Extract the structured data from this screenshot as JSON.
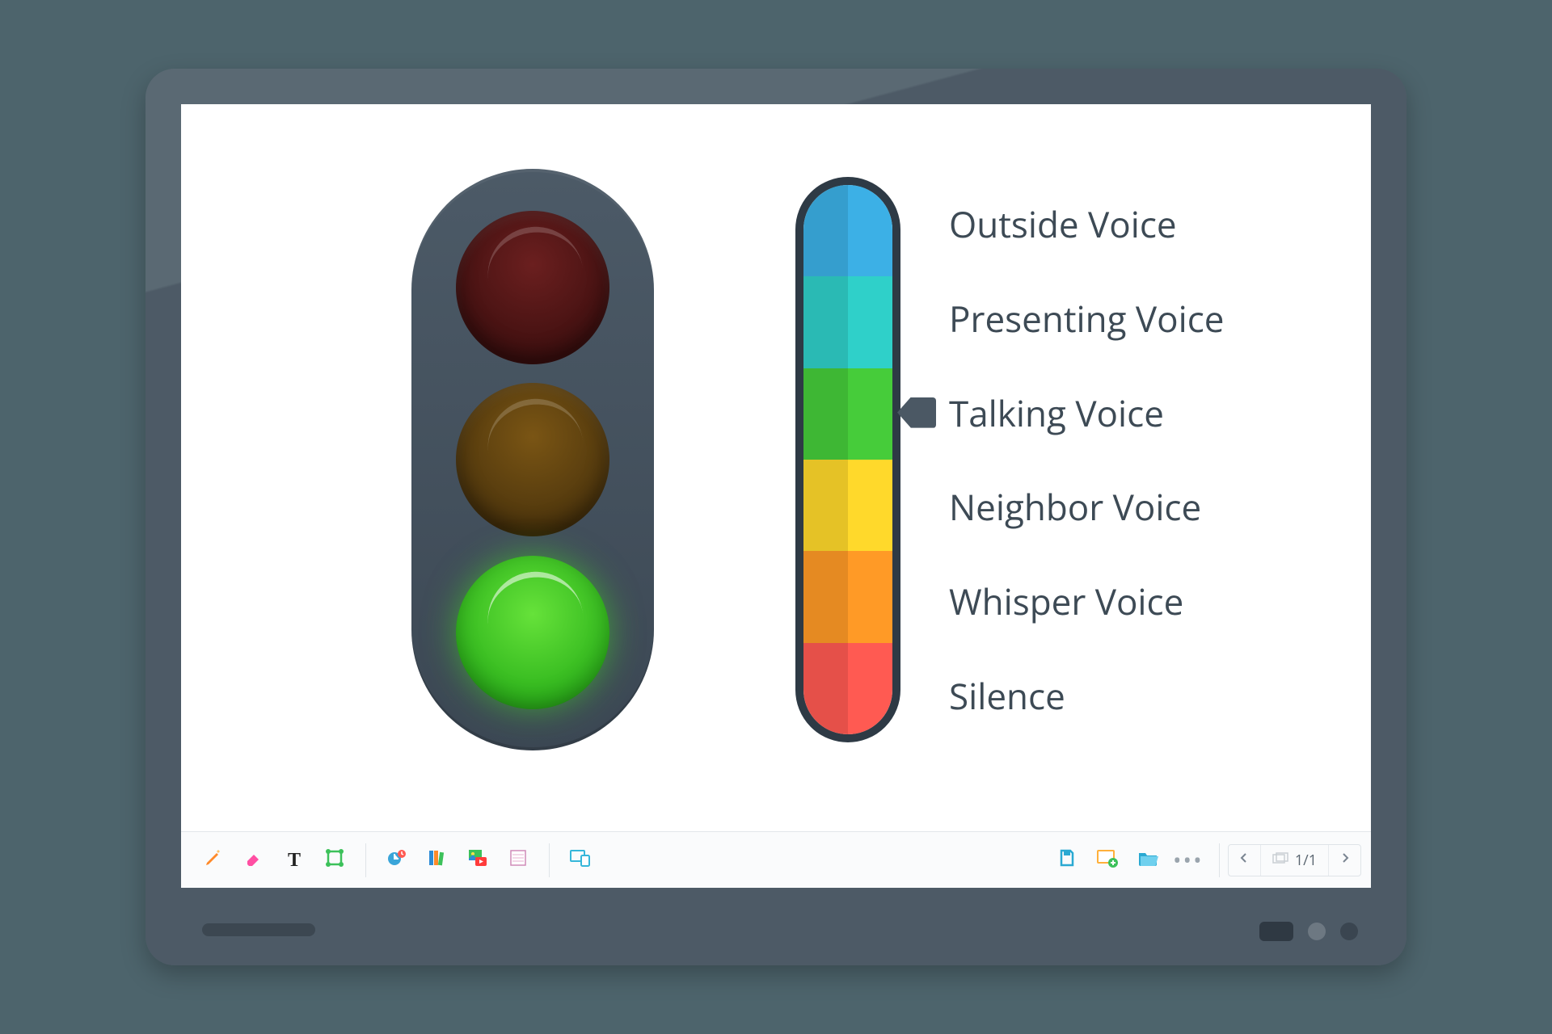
{
  "voice_levels": [
    {
      "label": "Outside Voice",
      "color": "#3cb0e6"
    },
    {
      "label": "Presenting Voice",
      "color": "#2fd0c9"
    },
    {
      "label": "Talking Voice",
      "color": "#46cc3a"
    },
    {
      "label": "Neighbor Voice",
      "color": "#ffd92b"
    },
    {
      "label": "Whisper Voice",
      "color": "#ff9a26"
    },
    {
      "label": "Silence",
      "color": "#ff5a52"
    }
  ],
  "selected_voice_index": 2,
  "traffic_light_state": "green",
  "toolbar": {
    "text_tool_label": "T"
  },
  "pages": {
    "label": "1/1"
  }
}
